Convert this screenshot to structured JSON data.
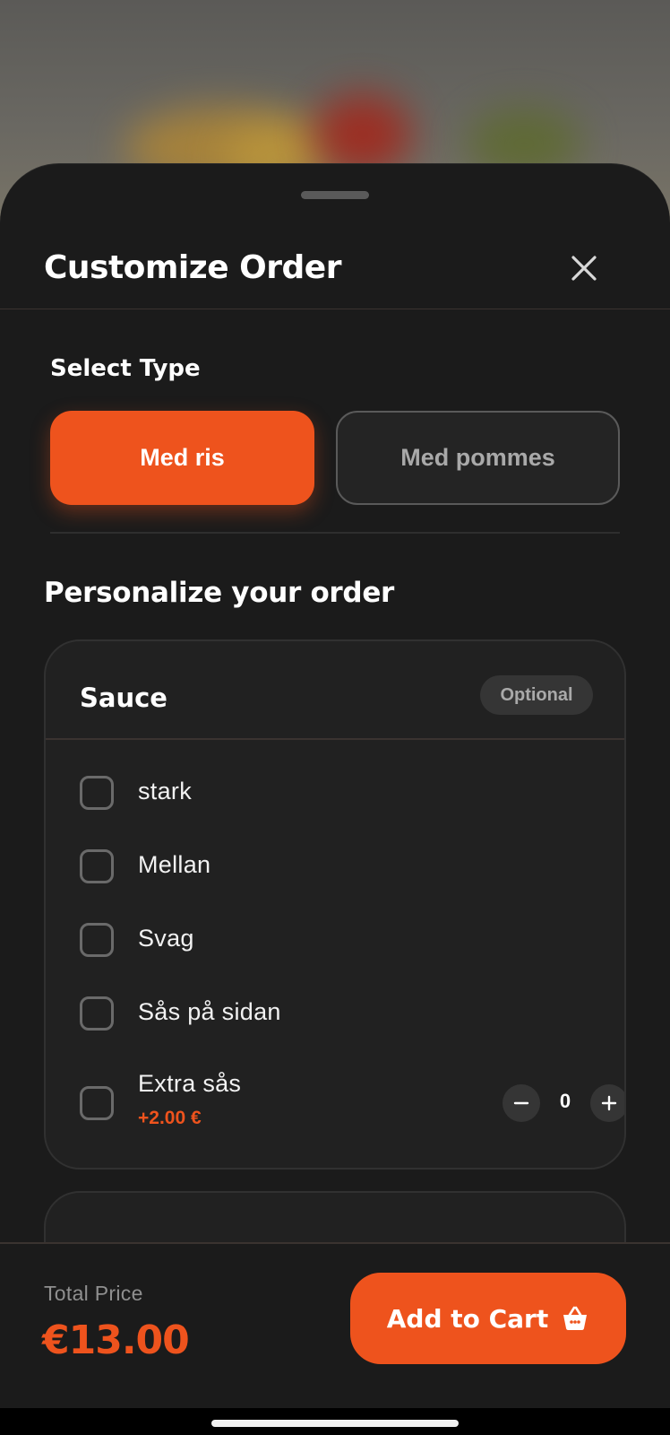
{
  "sheet": {
    "title": "Customize Order"
  },
  "select_type": {
    "label": "Select Type",
    "options": [
      {
        "label": "Med ris",
        "selected": true
      },
      {
        "label": "Med pommes",
        "selected": false
      }
    ]
  },
  "personalize": {
    "label": "Personalize your order"
  },
  "sauce_group": {
    "title": "Sauce",
    "badge": "Optional",
    "options": [
      {
        "label": "stark",
        "checked": false
      },
      {
        "label": "Mellan",
        "checked": false
      },
      {
        "label": "Svag",
        "checked": false
      },
      {
        "label": "Sås på sidan",
        "checked": false
      },
      {
        "label": "Extra sås",
        "price": "+2.00 €",
        "checked": false,
        "quantity": "0"
      }
    ]
  },
  "footer": {
    "total_label": "Total Price",
    "total_value": "€13.00",
    "add_to_cart": "Add to Cart"
  },
  "colors": {
    "accent": "#ee531d",
    "sheet_bg": "#1b1b1b",
    "card_bg": "#212121"
  },
  "icons": {
    "close": "close-icon",
    "cart": "basket-icon",
    "minus": "minus-icon",
    "plus": "plus-icon"
  }
}
